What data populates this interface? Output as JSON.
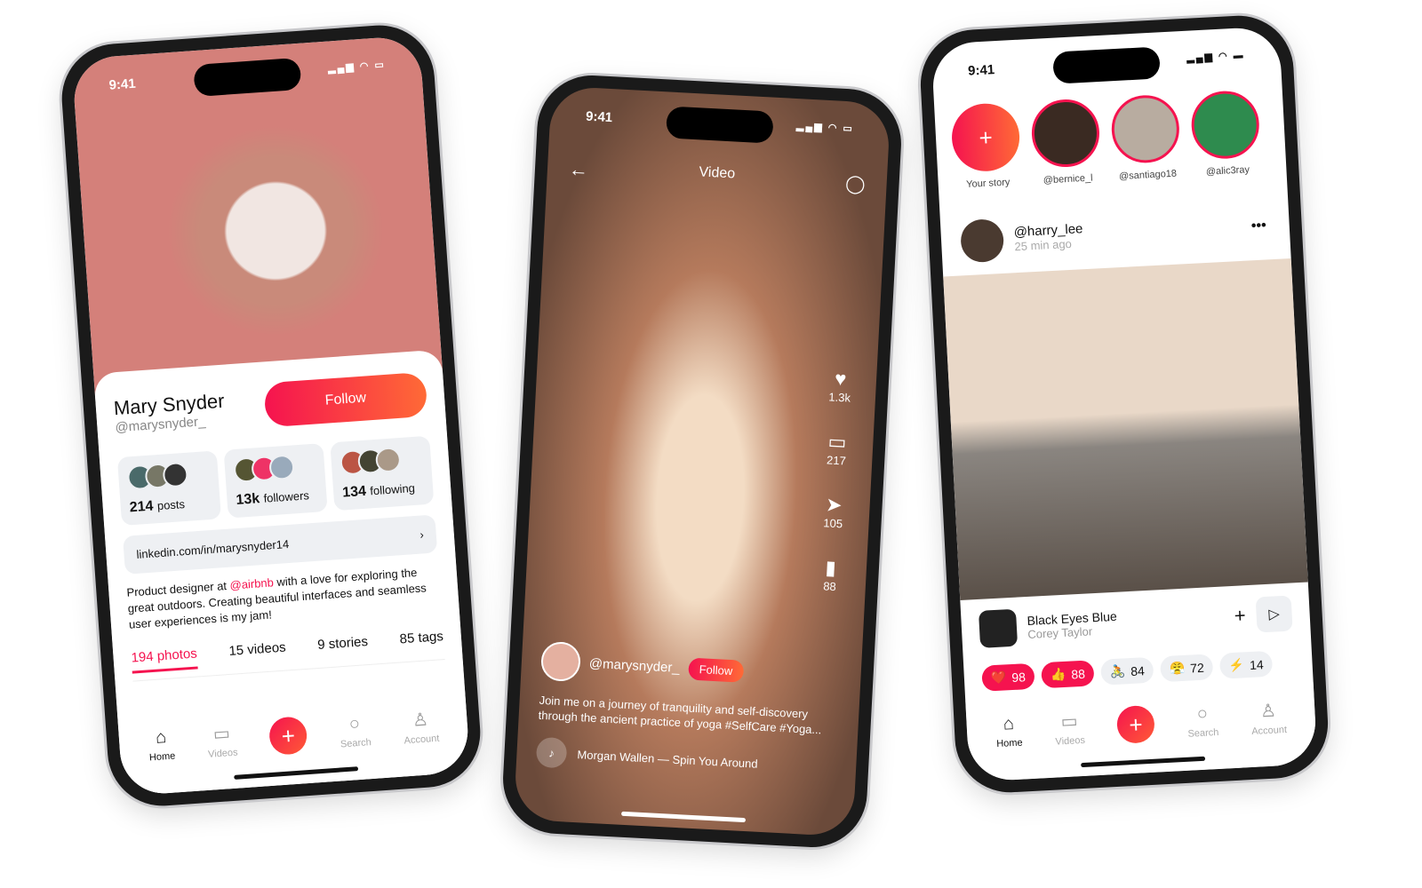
{
  "status_time": "9:41",
  "profile": {
    "name": "Mary Snyder",
    "handle": "@marysnyder_",
    "follow": "Follow",
    "stats": [
      {
        "num": "214",
        "label": "posts"
      },
      {
        "num": "13k",
        "label": "followers"
      },
      {
        "num": "134",
        "label": "following"
      }
    ],
    "link": "linkedin.com/in/marysnyder14",
    "bio_pre": "Product designer at ",
    "bio_mention": "@airbnb",
    "bio_post": " with a love for exploring the great outdoors. Creating beautiful interfaces and seamless user experiences is my jam!",
    "tabs": [
      "194 photos",
      "15 videos",
      "9 stories",
      "85 tags"
    ],
    "accent": "#f5134f"
  },
  "nav": [
    {
      "label": "Home",
      "icon": "home-icon"
    },
    {
      "label": "Videos",
      "icon": "video-icon"
    },
    {
      "label": "",
      "icon": "plus-icon"
    },
    {
      "label": "Search",
      "icon": "search-icon"
    },
    {
      "label": "Account",
      "icon": "account-icon"
    }
  ],
  "video": {
    "title": "Video",
    "likes": "1.3k",
    "comments": "217",
    "shares": "105",
    "saves": "88",
    "user": "@marysnyder_",
    "follow": "Follow",
    "caption": "Join me on a journey of tranquility and self-discovery through the ancient practice of yoga #SelfCare #Yoga...",
    "music": "Morgan Wallen — Spin You Around"
  },
  "feed": {
    "stories": [
      {
        "label": "Your story"
      },
      {
        "label": "@bernice_l"
      },
      {
        "label": "@santiago18"
      },
      {
        "label": "@alic3ray"
      }
    ],
    "post_user": "@harry_lee",
    "post_time": "25 min ago",
    "song": "Black Eyes Blue",
    "artist": "Corey Taylor",
    "reactions": [
      {
        "emoji": "❤️",
        "count": "98",
        "active": true
      },
      {
        "emoji": "👍",
        "count": "88",
        "active": true
      },
      {
        "emoji": "🚴",
        "count": "84"
      },
      {
        "emoji": "😤",
        "count": "72"
      },
      {
        "emoji": "⚡",
        "count": "14"
      }
    ]
  }
}
